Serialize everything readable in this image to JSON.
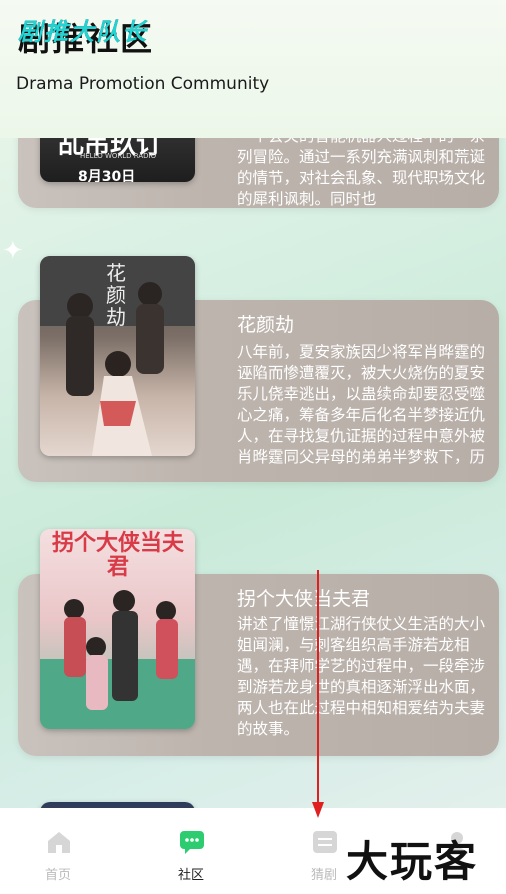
{
  "header": {
    "title": "剧推社区",
    "title_overlay": "剧推大队长",
    "subtitle": "Drama Promotion Community"
  },
  "cards": [
    {
      "poster_text_big": "乩吊玖订",
      "poster_text_small": "HELLO WORLD RADIO",
      "poster_text_date": "8月30日",
      "desc": "一个会笑的智能机器人过程中的一系列冒险。通过一系列充满讽刺和荒诞的情节，对社会乱象、现代职场文化的犀利讽刺。同时也"
    },
    {
      "poster_title": "花颜劫",
      "title": "花颜劫",
      "desc": "八年前，夏安家族因少将军肖晔霆的诬陷而惨遭覆灭，被大火烧伤的夏安乐儿侥幸逃出，以蛊续命却要忍受噬心之痛，筹备多年后化名半梦接近仇人，在寻找复仇证据的过程中意外被肖晔霆同父异母的弟弟半梦救下，历史"
    },
    {
      "poster_title": "拐个大侠当夫君",
      "title": "拐个大侠当夫君",
      "desc": "讲述了憧憬江湖行侠仗义生活的大小姐闻澜，与刺客组织高手游若龙相遇，在拜师学艺的过程中，一段牵涉到游若龙身世的真相逐渐浮出水面，两人也在此过程中相知相爱结为夫妻的故事。"
    }
  ],
  "tabbar": {
    "home": "首页",
    "community": "社区",
    "drama": "猜剧",
    "mine": ""
  },
  "watermark": "大玩客",
  "colors": {
    "accent": "#2ecc71",
    "card_bg": "#bdb4ad"
  }
}
